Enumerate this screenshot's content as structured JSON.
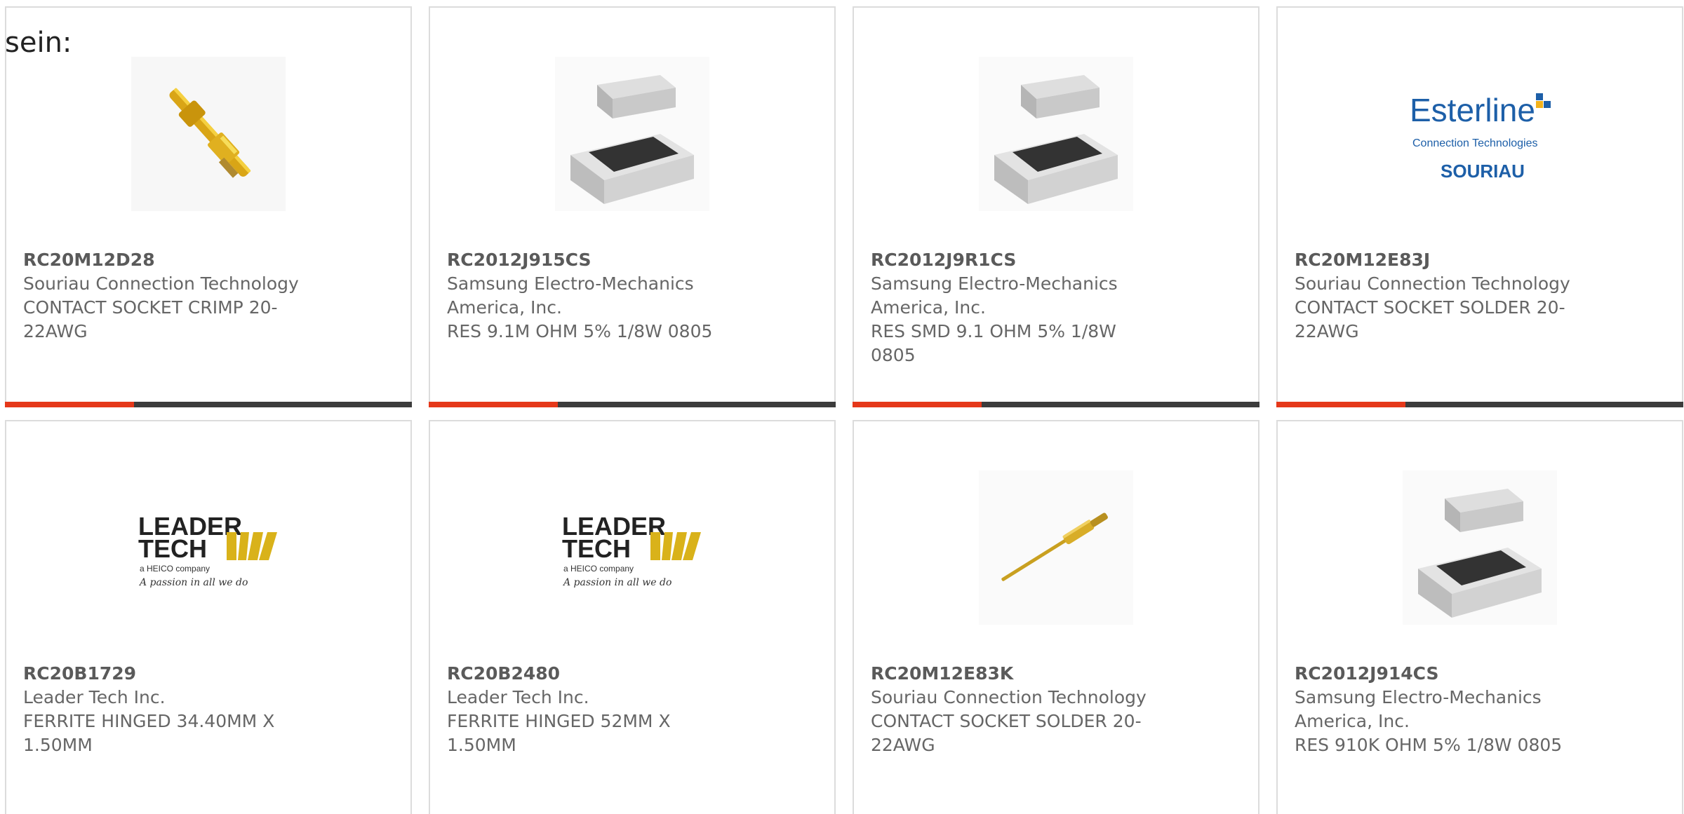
{
  "intro_text": "sein:",
  "colors": {
    "accent": "#e5381a",
    "bar": "#3c3c3c",
    "card_border": "#dcdcdc",
    "text": "#666666"
  },
  "products": [
    {
      "part": "RC20M12D28",
      "manufacturer": "Souriau Connection Technology",
      "description": "CONTACT SOCKET CRIMP 20-22AWG",
      "image": "crimp-contact-image"
    },
    {
      "part": "RC2012J915CS",
      "manufacturer": "Samsung Electro-Mechanics America, Inc.",
      "description": "RES 9.1M OHM 5% 1/8W 0805",
      "image": "smd-resistor-image"
    },
    {
      "part": "RC2012J9R1CS",
      "manufacturer": "Samsung Electro-Mechanics America, Inc.",
      "description": "RES SMD 9.1 OHM 5% 1/8W 0805",
      "image": "smd-resistor-image"
    },
    {
      "part": "RC20M12E83J",
      "manufacturer": "Souriau Connection Technology",
      "description": "CONTACT SOCKET SOLDER 20-22AWG",
      "image": "esterline-souriau-logo",
      "logo_text": [
        "Esterline",
        "Connection Technologies",
        "SOURIAU"
      ]
    },
    {
      "part": "RC20B1729",
      "manufacturer": "Leader Tech Inc.",
      "description": "FERRITE HINGED 34.40MM X 1.50MM",
      "image": "leader-tech-logo",
      "logo_text": [
        "LEADER",
        "TECH",
        "a HEICO company",
        "A passion in all we do"
      ]
    },
    {
      "part": "RC20B2480",
      "manufacturer": "Leader Tech Inc.",
      "description": "FERRITE HINGED 52MM X 1.50MM",
      "image": "leader-tech-logo",
      "logo_text": [
        "LEADER",
        "TECH",
        "a HEICO company",
        "A passion in all we do"
      ]
    },
    {
      "part": "RC20M12E83K",
      "manufacturer": "Souriau Connection Technology",
      "description": "CONTACT SOCKET SOLDER 20-22AWG",
      "image": "pin-contact-image"
    },
    {
      "part": "RC2012J914CS",
      "manufacturer": "Samsung Electro-Mechanics America, Inc.",
      "description": "RES 910K OHM 5% 1/8W 0805",
      "image": "smd-resistor-image"
    }
  ]
}
